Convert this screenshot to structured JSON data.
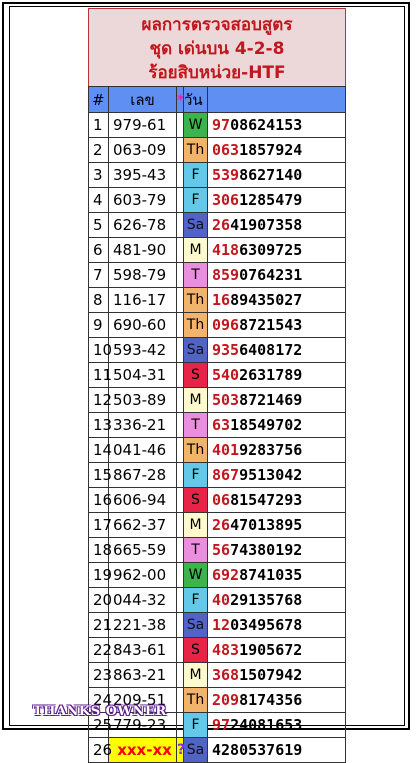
{
  "header": {
    "line1": "ผลการตรวจสอบสูตร",
    "line2": "ชุด เด่นบน 4-2-8",
    "line3": "ร้อยสิบหน่วย-HTF"
  },
  "columns": {
    "num": "#",
    "code": "เลข",
    "star": "*",
    "day": "วัน"
  },
  "rows": [
    {
      "n": "1",
      "code": "979-61",
      "day": "W",
      "red": "97",
      "rest": "08624153"
    },
    {
      "n": "2",
      "code": "063-09",
      "day": "Th",
      "red": "063",
      "rest": "1857924"
    },
    {
      "n": "3",
      "code": "395-43",
      "day": "F",
      "red": "539",
      "rest": "8627140"
    },
    {
      "n": "4",
      "code": "603-79",
      "day": "F",
      "red": "306",
      "rest": "1285479"
    },
    {
      "n": "5",
      "code": "626-78",
      "day": "Sa",
      "red": "26",
      "rest": "41907358"
    },
    {
      "n": "6",
      "code": "481-90",
      "day": "M",
      "red": "418",
      "rest": "6309725"
    },
    {
      "n": "7",
      "code": "598-79",
      "day": "T",
      "red": "859",
      "rest": "0764231"
    },
    {
      "n": "8",
      "code": "116-17",
      "day": "Th",
      "red": "16",
      "rest": "89435027"
    },
    {
      "n": "9",
      "code": "690-60",
      "day": "Th",
      "red": "096",
      "rest": "8721543"
    },
    {
      "n": "10",
      "code": "593-42",
      "day": "Sa",
      "red": "935",
      "rest": "6408172"
    },
    {
      "n": "11",
      "code": "504-31",
      "day": "S",
      "red": "540",
      "rest": "2631789"
    },
    {
      "n": "12",
      "code": "503-89",
      "day": "M",
      "red": "503",
      "rest": "8721469"
    },
    {
      "n": "13",
      "code": "336-21",
      "day": "T",
      "red": "63",
      "rest": "18549702"
    },
    {
      "n": "14",
      "code": "041-46",
      "day": "Th",
      "red": "401",
      "rest": "9283756"
    },
    {
      "n": "15",
      "code": "867-28",
      "day": "F",
      "red": "867",
      "rest": "9513042"
    },
    {
      "n": "16",
      "code": "606-94",
      "day": "S",
      "red": "06",
      "rest": "81547293"
    },
    {
      "n": "17",
      "code": "662-37",
      "day": "M",
      "red": "26",
      "rest": "47013895"
    },
    {
      "n": "18",
      "code": "665-59",
      "day": "T",
      "red": "56",
      "rest": "74380192"
    },
    {
      "n": "19",
      "code": "962-00",
      "day": "W",
      "red": "692",
      "rest": "8741035"
    },
    {
      "n": "20",
      "code": "044-32",
      "day": "F",
      "red": "40",
      "rest": "29135768"
    },
    {
      "n": "21",
      "code": "221-38",
      "day": "Sa",
      "red": "12",
      "rest": "03495678"
    },
    {
      "n": "22",
      "code": "843-61",
      "day": "S",
      "red": "483",
      "rest": "1905672"
    },
    {
      "n": "23",
      "code": "863-21",
      "day": "M",
      "red": "368",
      "rest": "1507942"
    },
    {
      "n": "24",
      "code": "209-51",
      "day": "Th",
      "red": "209",
      "rest": "8174356"
    },
    {
      "n": "25",
      "code": "779-23",
      "day": "F",
      "red": "97",
      "rest": "24081653"
    },
    {
      "n": "26",
      "code": "xxx-xx",
      "day": "Sa",
      "red": "",
      "rest": "4280537619",
      "q": "?"
    }
  ],
  "day_colors": {
    "W": "#3cb44b",
    "Th": "#f2b36b",
    "F": "#62c9ea",
    "Sa": "#5163c7",
    "M": "#fffacd",
    "T": "#ea8fde",
    "S": "#e62447"
  },
  "footer": {
    "thanks": "THANKS OWNER"
  }
}
